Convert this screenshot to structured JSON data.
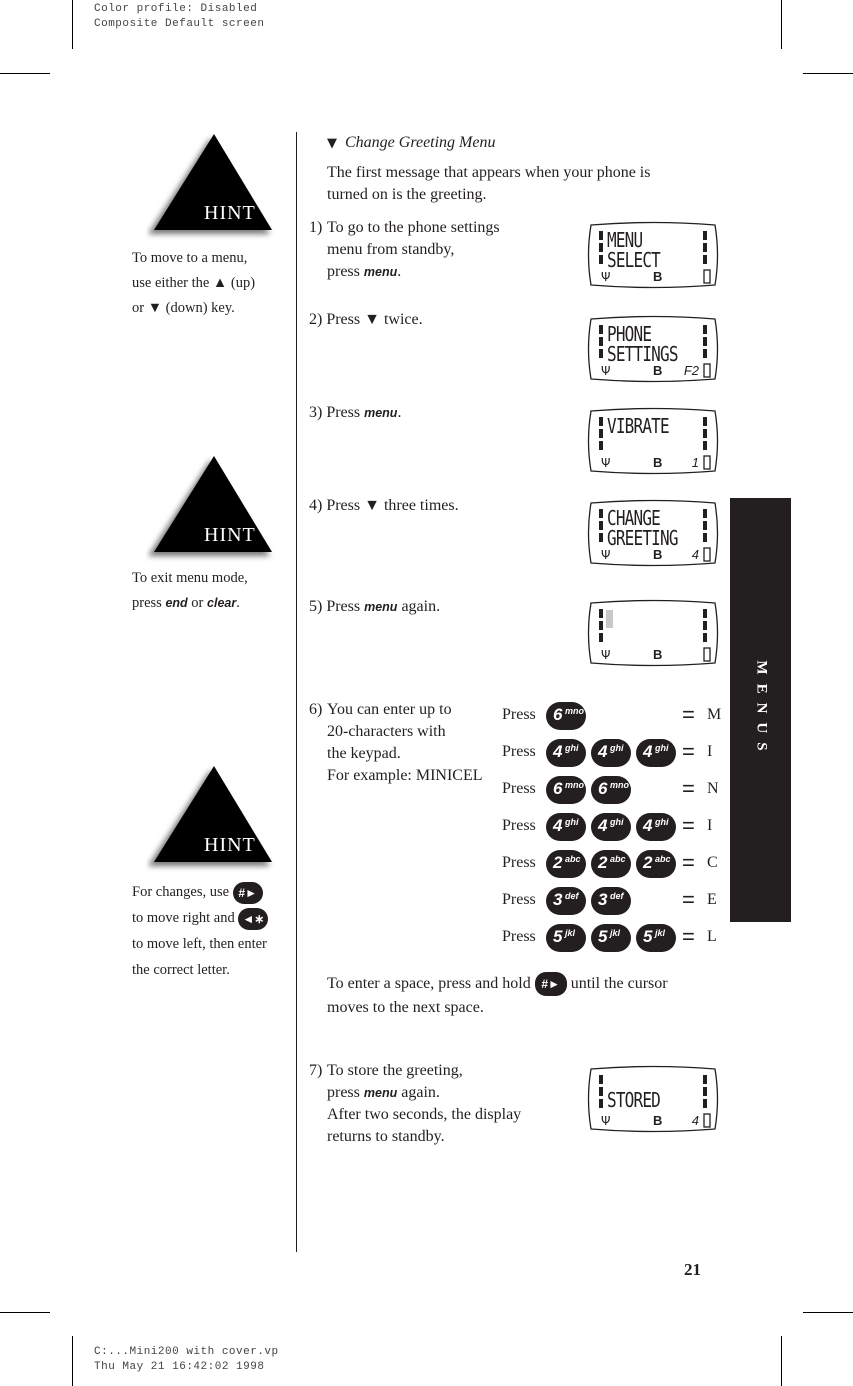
{
  "print_header": {
    "line1": "Color profile: Disabled",
    "line2": "Composite  Default screen"
  },
  "print_footer": {
    "line1": "C:...Mini200 with cover.vp",
    "line2": "Thu May 21 16:42:02 1998"
  },
  "page_number": "21",
  "section_tab": "MENUS",
  "hints": [
    {
      "label": "HINT",
      "lines": [
        "To move to a menu,",
        "use either the ▲ (up)",
        "or ▼ (down) key."
      ]
    },
    {
      "label": "HINT",
      "line1": "To exit menu mode,",
      "line2_prefix": "press ",
      "key_end": "end",
      "line2_mid": " or ",
      "key_clear": "clear",
      "line2_suffix": "."
    },
    {
      "label": "HINT",
      "line1_prefix": "For changes, use",
      "key_right": "#►",
      "line2_prefix": "to move right and",
      "key_left": "◄∗",
      "line3": "to move left, then enter",
      "line4": "the correct letter."
    }
  ],
  "heading": "Change Greeting Menu",
  "heading_icon": "▼",
  "intro": [
    "The first message that appears when your phone is",
    "turned on is the greeting."
  ],
  "steps": [
    {
      "num": "1)",
      "lines": [
        "To go to the phone settings",
        "menu from standby,"
      ],
      "last_prefix": "press ",
      "key": "menu",
      "last_suffix": "."
    },
    {
      "num": "2)",
      "text": "Press ▼ twice."
    },
    {
      "num": "3)",
      "prefix": "Press ",
      "key": "menu",
      "suffix": "."
    },
    {
      "num": "4)",
      "text": "Press ▼ three times."
    },
    {
      "num": "5)",
      "prefix": "Press ",
      "key": "menu",
      "suffix": " again."
    },
    {
      "num": "6)",
      "lines": [
        "You can enter up to",
        "20-characters with",
        "the keypad.",
        "For example: MINICEL"
      ]
    },
    {
      "num": "7)",
      "line1": "To store the greeting,",
      "line2_prefix": "press ",
      "key": "menu",
      "line2_suffix": " again.",
      "line3": "After two seconds, the display",
      "line4": "returns to standby."
    }
  ],
  "displays": [
    {
      "line1": "MENU",
      "line2": "SELECT",
      "indicator": "B",
      "number": ""
    },
    {
      "line1": "PHONE",
      "line2": "SETTINGS",
      "indicator": "B",
      "number": "F2"
    },
    {
      "line1": "VIBRATE",
      "line2": "",
      "indicator": "B",
      "number": "1"
    },
    {
      "line1": "CHANGE",
      "line2": "GREETING",
      "indicator": "B",
      "number": "4"
    },
    {
      "line1": "",
      "line2": "",
      "indicator": "B",
      "number": "",
      "cursor": true
    },
    {
      "line1": "",
      "line2": "STORED",
      "indicator": "B",
      "number": "4"
    }
  ],
  "keypad_example": {
    "press_label": "Press",
    "equals": "=",
    "rows": [
      {
        "digit": "6",
        "letters": "mno",
        "count": 1,
        "result": "M"
      },
      {
        "digit": "4",
        "letters": "ghi",
        "count": 3,
        "result": "I"
      },
      {
        "digit": "6",
        "letters": "mno",
        "count": 2,
        "result": "N"
      },
      {
        "digit": "4",
        "letters": "ghi",
        "count": 3,
        "result": "I"
      },
      {
        "digit": "2",
        "letters": "abc",
        "count": 3,
        "result": "C"
      },
      {
        "digit": "3",
        "letters": "def",
        "count": 2,
        "result": "E"
      },
      {
        "digit": "5",
        "letters": "jkl",
        "count": 3,
        "result": "L"
      }
    ]
  },
  "space_note": {
    "prefix": "To enter a space, press and hold",
    "key": "#►",
    "suffix": "until the cursor",
    "line2": "moves to the next space."
  }
}
